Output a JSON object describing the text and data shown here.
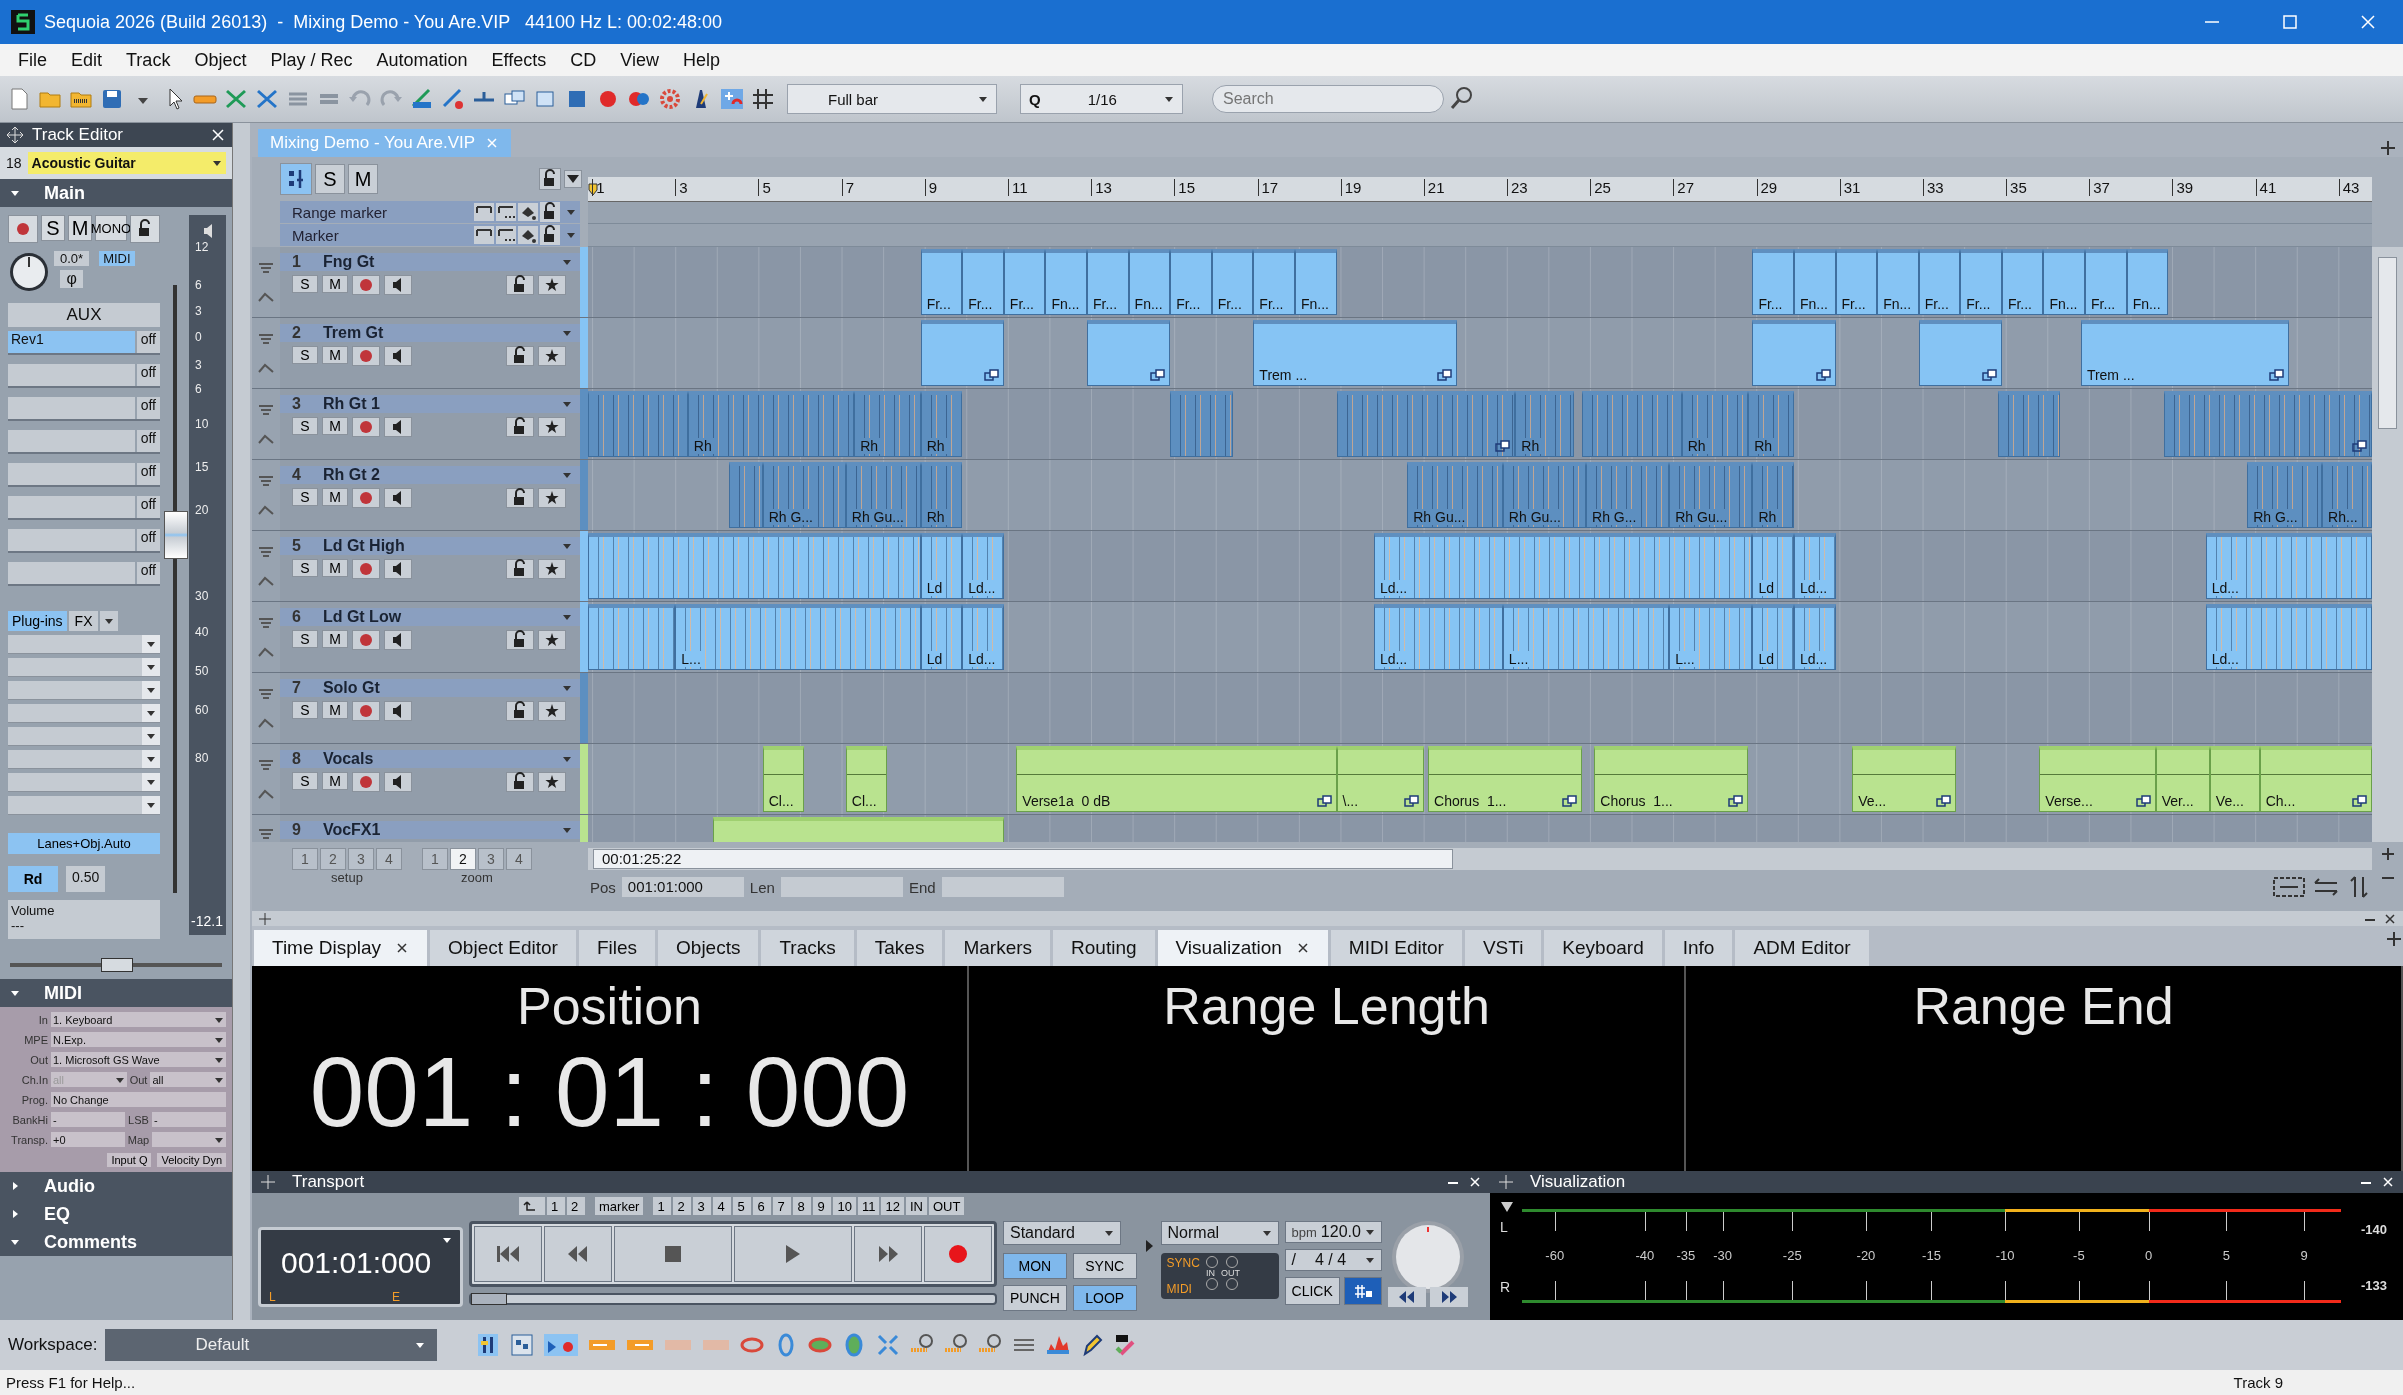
{
  "window": {
    "title": "Sequoia 2026 (Build 26013)  -  Mixing Demo - You Are.VIP   44100 Hz L: 00:02:48:00"
  },
  "menu": [
    "File",
    "Edit",
    "Track",
    "Object",
    "Play / Rec",
    "Automation",
    "Effects",
    "CD",
    "View",
    "Help"
  ],
  "toolbar": {
    "snap": "Full bar",
    "quantize_label": "Q",
    "quantize": "1/16",
    "search": {
      "placeholder": "Search"
    }
  },
  "track_editor": {
    "title": "Track Editor",
    "track_number": "18",
    "track_name": "Acoustic Guitar",
    "main": {
      "title": "Main",
      "solo": "S",
      "mute": "M",
      "mono": "MONO",
      "pan_value": "0.0*",
      "midi": "MIDI",
      "phase": "φ",
      "aux": "AUX",
      "sends": [
        {
          "name": "Rev1",
          "value": "off",
          "on": true
        },
        {
          "value": "off",
          "on": false
        },
        {
          "value": "off",
          "on": false
        },
        {
          "value": "off",
          "on": false
        },
        {
          "value": "off",
          "on": false
        },
        {
          "value": "off",
          "on": false
        },
        {
          "value": "off",
          "on": false
        },
        {
          "value": "off",
          "on": false
        }
      ],
      "plugins": {
        "label": "Plug-ins",
        "fx": "FX",
        "on": true
      },
      "lanes": "Lanes+Obj.Auto",
      "read": "Rd",
      "read_value": "0.50",
      "volume_label": "Volume",
      "volume_value": "---",
      "fader": {
        "level": 0.59
      },
      "scale": [
        "12",
        "6",
        "3",
        "0",
        "3",
        "6",
        "10",
        "15",
        "20",
        "30",
        "40",
        "50",
        "60",
        "80"
      ],
      "reading": "-12.1",
      "pan": {
        "level": 0.5
      }
    },
    "midi": {
      "title": "MIDI",
      "rows": [
        {
          "label": "In",
          "value": "1. Keyboard"
        },
        {
          "label": "MPE",
          "value": "N.Exp."
        },
        {
          "label": "Out",
          "value": "1. Microsoft GS Wave"
        }
      ],
      "ch_in_label": "Ch.In",
      "ch_in": "all",
      "ch_out_label": "Out",
      "ch_out": "all",
      "prog_label": "Prog.",
      "prog": "No Change",
      "bank_label": "BankHi",
      "bank": "-",
      "lsb_label": "LSB",
      "lsb": "-",
      "transp_label": "Transp.",
      "transp": "+0",
      "map_label": "Map",
      "buttons": [
        "Input Q",
        "Velocity Dyn"
      ]
    },
    "sections": [
      {
        "title": "Audio",
        "expanded": false
      },
      {
        "title": "EQ",
        "expanded": false
      },
      {
        "title": "Comments",
        "expanded": true
      }
    ]
  },
  "arrange": {
    "tab": "Mixing Demo - You Are.VIP",
    "solo": "S",
    "mute": "M",
    "ruler": [
      "1",
      "3",
      "5",
      "7",
      "9",
      "11",
      "13",
      "15",
      "17",
      "19",
      "21",
      "23",
      "25",
      "27",
      "29",
      "31",
      "33",
      "35",
      "37",
      "39",
      "41",
      "43"
    ],
    "markers": [
      "Range marker",
      "Marker"
    ],
    "tracks": [
      {
        "number": "1",
        "name": "Fng Gt",
        "color": "#86c4f4",
        "solo": "S",
        "mute": "M",
        "kind": "plain",
        "clips": [
          {
            "label": "Fr...",
            "linked": false
          },
          {
            "label": "Fr...",
            "linked": false
          },
          {
            "label": "Fr...",
            "linked": false
          },
          {
            "label": "Fn...",
            "linked": false
          },
          {
            "label": "Fr...",
            "linked": false
          },
          {
            "label": "Fn...",
            "linked": false
          },
          {
            "label": "Fr...",
            "linked": false
          },
          {
            "label": "Fr...",
            "linked": false
          },
          {
            "label": "Fr...",
            "linked": false
          },
          {
            "label": "Fn...",
            "linked": false
          },
          {
            "label": "Fr...",
            "linked": false
          },
          {
            "label": "Fn...",
            "linked": false
          },
          {
            "label": "Fr...",
            "linked": false
          },
          {
            "label": "Fn...",
            "linked": false
          },
          {
            "label": "Fr...",
            "linked": false
          },
          {
            "label": "Fr...",
            "linked": false
          },
          {
            "label": "Fr...",
            "linked": false
          },
          {
            "label": "Fn...",
            "linked": false
          },
          {
            "label": "Fr...",
            "linked": false
          },
          {
            "label": "Fn...",
            "linked": false
          }
        ]
      },
      {
        "number": "2",
        "name": "Trem Gt",
        "color": "#86c4f4",
        "solo": "S",
        "mute": "M",
        "kind": "plain",
        "clips": [
          {
            "linked": true
          },
          {
            "linked": true
          },
          {
            "label": "Trem ...",
            "linked": true
          },
          {
            "linked": true
          },
          {
            "linked": true
          },
          {
            "label": "Trem ...",
            "linked": true
          }
        ]
      },
      {
        "number": "3",
        "name": "Rh Gt 1",
        "color": "#5d8fc0",
        "solo": "S",
        "mute": "M",
        "kind": "dense",
        "clips": [
          {
            "linked": false
          },
          {
            "label": "Rh",
            "linked": false
          },
          {
            "label": "Rh",
            "linked": false
          },
          {
            "label": "Rh",
            "linked": false
          },
          {
            "linked": false
          },
          {
            "linked": true
          },
          {
            "label": "Rh",
            "linked": false
          },
          {
            "linked": false
          },
          {
            "label": "Rh",
            "linked": false
          },
          {
            "label": "Rh",
            "linked": false
          },
          {
            "linked": false
          },
          {
            "linked": true
          }
        ]
      },
      {
        "number": "4",
        "name": "Rh Gt 2",
        "color": "#5d8fc0",
        "solo": "S",
        "mute": "M",
        "kind": "dense",
        "clips": [
          {
            "linked": false
          },
          {
            "label": "Rh G...",
            "linked": false
          },
          {
            "label": "Rh Gu...",
            "linked": false
          },
          {
            "label": "Rh",
            "linked": false
          },
          {
            "label": "Rh Gu...",
            "linked": false
          },
          {
            "label": "Rh Gu...",
            "linked": false
          },
          {
            "label": "Rh G...",
            "linked": false
          },
          {
            "label": "Rh Gu...",
            "linked": false
          },
          {
            "label": "Rh",
            "linked": false
          },
          {
            "label": "Rh G...",
            "linked": false
          },
          {
            "label": "Rh...",
            "linked": false
          }
        ]
      },
      {
        "number": "5",
        "name": "Ld Gt High",
        "color": "#86c4f4",
        "solo": "S",
        "mute": "M",
        "kind": "dense",
        "clips": [
          {
            "linked": false
          },
          {
            "label": "Ld",
            "linked": false
          },
          {
            "label": "Ld...",
            "linked": false
          },
          {
            "label": "Ld...",
            "linked": false
          },
          {
            "label": "Ld",
            "linked": false
          },
          {
            "label": "Ld...",
            "linked": false
          },
          {
            "label": "Ld...",
            "linked": false
          }
        ]
      },
      {
        "number": "6",
        "name": "Ld Gt Low",
        "color": "#86c4f4",
        "solo": "S",
        "mute": "M",
        "kind": "dense",
        "clips": [
          {
            "linked": false
          },
          {
            "label": "L...",
            "linked": false
          },
          {
            "label": "Ld",
            "linked": false
          },
          {
            "label": "Ld...",
            "linked": false
          },
          {
            "label": "Ld...",
            "linked": false
          },
          {
            "label": "L...",
            "linked": false
          },
          {
            "label": "L...",
            "linked": false
          },
          {
            "label": "Ld",
            "linked": false
          },
          {
            "label": "Ld...",
            "linked": false
          },
          {
            "label": "Ld...",
            "linked": false
          }
        ]
      },
      {
        "number": "7",
        "name": "Solo Gt",
        "color": "#5d8fc0",
        "solo": "S",
        "mute": "M"
      },
      {
        "number": "8",
        "name": "Vocals",
        "color": "#b9e38f",
        "solo": "S",
        "mute": "M",
        "kind": "wave",
        "clips": [
          {
            "label": "Cl...",
            "linked": false
          },
          {
            "label": "Cl...",
            "linked": false
          },
          {
            "label": "Verse1a  0 dB",
            "linked": true
          },
          {
            "label": "\\...",
            "linked": true
          },
          {
            "label": "Chorus  1...",
            "linked": true
          },
          {
            "label": "Chorus  1...",
            "linked": true
          },
          {
            "label": "Ve...",
            "linked": true
          },
          {
            "label": "Verse...",
            "linked": true
          },
          {
            "label": "Ver...",
            "linked": false
          },
          {
            "label": "Ve...",
            "linked": false
          },
          {
            "label": "Ch...",
            "linked": true
          }
        ]
      },
      {
        "number": "9",
        "name": "VocFX1",
        "color": "#b9e38f",
        "kind": "wave",
        "clips": [
          {
            "linked": false
          }
        ]
      }
    ],
    "setup": {
      "buttons": [
        {
          "label": "1",
          "selected": false
        },
        {
          "label": "2",
          "selected": false
        },
        {
          "label": "3",
          "selected": false
        },
        {
          "label": "4",
          "selected": false
        }
      ],
      "label": "setup"
    },
    "zoom": {
      "buttons": [
        {
          "label": "1",
          "selected": false
        },
        {
          "label": "2",
          "selected": true
        },
        {
          "label": "3",
          "selected": false
        },
        {
          "label": "4",
          "selected": false
        }
      ],
      "label": "zoom"
    },
    "scroll_time": "00:01:25:22",
    "pos_label": "Pos",
    "pos": "001:01:000",
    "len_label": "Len",
    "end_label": "End"
  },
  "bottom_tabs": [
    {
      "label": "Time Display",
      "selected": true,
      "closable": true
    },
    {
      "label": "Object Editor",
      "selected": false,
      "closable": false
    },
    {
      "label": "Files",
      "selected": false,
      "closable": false
    },
    {
      "label": "Objects",
      "selected": false,
      "closable": false
    },
    {
      "label": "Tracks",
      "selected": false,
      "closable": false
    },
    {
      "label": "Takes",
      "selected": false,
      "closable": false
    },
    {
      "label": "Markers",
      "selected": false,
      "closable": false
    },
    {
      "label": "Routing",
      "selected": false,
      "closable": false
    },
    {
      "label": "Visualization",
      "selected": true,
      "closable": true
    },
    {
      "label": "MIDI Editor",
      "selected": false,
      "closable": false
    },
    {
      "label": "VSTi",
      "selected": false,
      "closable": false
    },
    {
      "label": "Keyboard",
      "selected": false,
      "closable": false
    },
    {
      "label": "Info",
      "selected": false,
      "closable": false
    },
    {
      "label": "ADM Editor",
      "selected": false,
      "closable": false
    }
  ],
  "time_display": [
    {
      "title": "Position",
      "value": "001 : 01 : 000"
    },
    {
      "title": "Range Length"
    },
    {
      "title": "Range End"
    }
  ],
  "transport": {
    "title": "Transport",
    "jump": [
      "1",
      "2"
    ],
    "marker": "marker",
    "markers": [
      "1",
      "2",
      "3",
      "4",
      "5",
      "6",
      "7",
      "8",
      "9",
      "10",
      "11",
      "12"
    ],
    "in": "IN",
    "out": "OUT",
    "time": "001:01:000",
    "l": "L",
    "e": "E",
    "position": {
      "level": 0
    },
    "mode": "Standard",
    "toggles": [
      {
        "label": "MON",
        "on": true
      },
      {
        "label": "SYNC",
        "on": false
      },
      {
        "label": "PUNCH",
        "on": false
      },
      {
        "label": "LOOP",
        "on": true
      }
    ],
    "speed": "Normal",
    "sync": "SYNC",
    "midi": "MIDI",
    "sync_in": "IN",
    "sync_out": "OUT",
    "bpm_label": "bpm",
    "bpm": "120.0",
    "sig_label": "/",
    "signature": "4 / 4",
    "click": "CLICK"
  },
  "visualization": {
    "title": "Visualization",
    "channels": [
      "L",
      "R"
    ],
    "scale": [
      "-60",
      "-40",
      "-35",
      "-30",
      "-25",
      "-20",
      "-15",
      "-10",
      "-5",
      "0",
      "5",
      "9"
    ],
    "peaks": [
      "-140",
      "-133"
    ]
  },
  "workspace": {
    "label": "Workspace:",
    "value": "Default"
  },
  "status_bar": {
    "help": "Press F1 for Help...",
    "track": "Track 9"
  }
}
